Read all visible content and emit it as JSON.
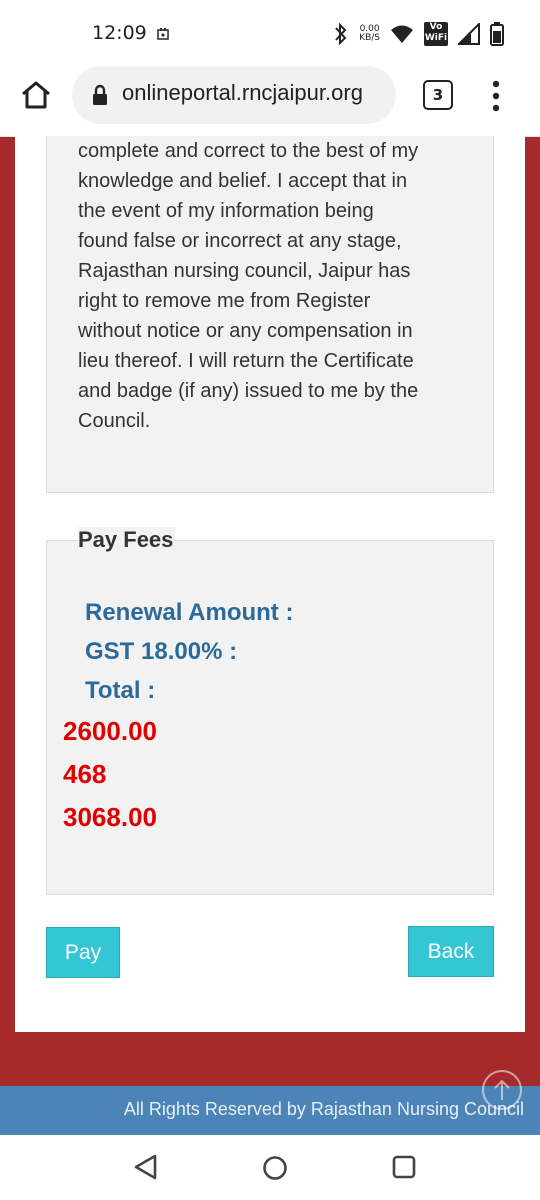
{
  "status_bar": {
    "time": "12:09",
    "speed_value": "0.00",
    "speed_unit": "KB/S",
    "volte_label": "Vo",
    "wifi_label": "WiFi"
  },
  "browser": {
    "url": "onlineportal.rncjaipur.org",
    "tab_count": "3"
  },
  "declaration": {
    "text": "complete and correct to the best of my knowledge and belief. I accept that in the event of my information being found false or incorrect at any stage, Rajasthan nursing council, Jaipur has right to remove me from Register without notice or any compensation in lieu thereof. I will return the Certificate and badge (if any) issued to me by the Council."
  },
  "fees": {
    "legend": "Pay Fees",
    "renewal_label": "Renewal Amount :",
    "gst_label": "GST 18.00% :",
    "total_label": "Total :",
    "renewal_amount": "2600.00",
    "gst_amount": "468",
    "total_amount": "3068.00"
  },
  "buttons": {
    "pay": "Pay",
    "back": "Back"
  },
  "footer": {
    "text": "All Rights Reserved by Rajasthan Nursing Council"
  },
  "colors": {
    "background": "#a52a2a",
    "label_blue": "#2b6a9a",
    "amount_red": "#e00000",
    "button_teal": "#34c6d3",
    "footer_blue": "#4c84b7"
  }
}
